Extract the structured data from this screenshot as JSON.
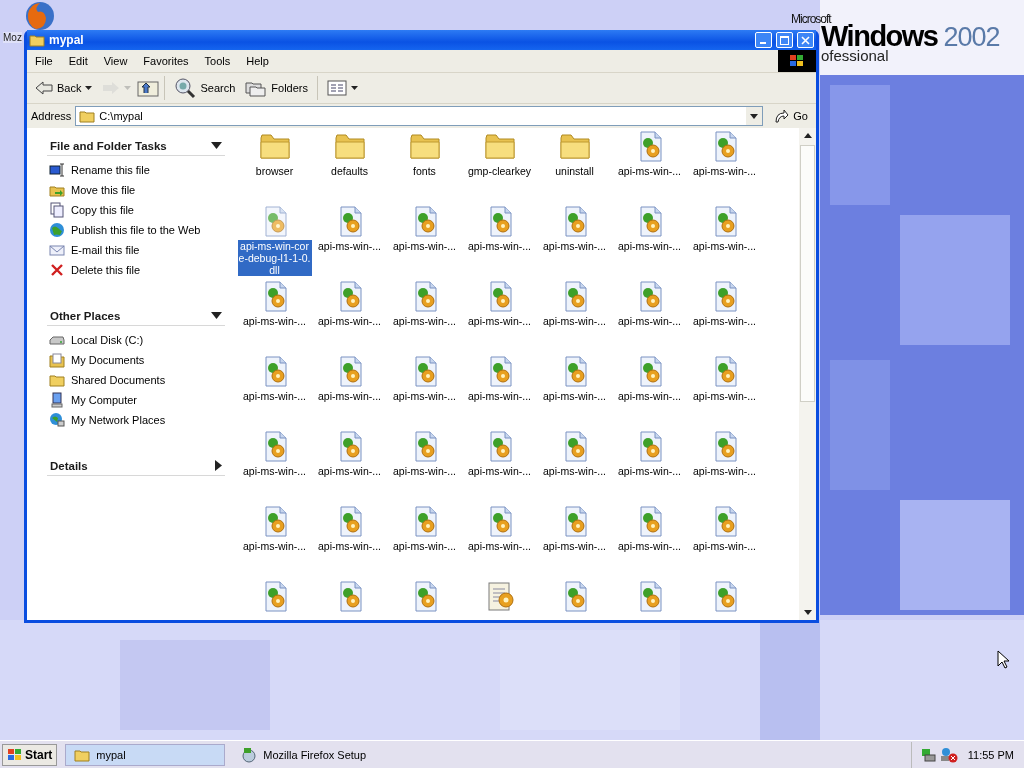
{
  "desktop": {
    "icons": [
      {
        "label": "Moz",
        "kind": "firefox"
      }
    ],
    "logo": {
      "maker": "Microsoft",
      "product": "Windows",
      "version": "2002",
      "edition": "ofessional"
    }
  },
  "window": {
    "title": "mypal",
    "menu": [
      "File",
      "Edit",
      "View",
      "Favorites",
      "Tools",
      "Help"
    ],
    "toolbar": [
      {
        "kind": "back",
        "label": "Back",
        "disabled": false
      },
      {
        "kind": "forward",
        "disabled": true
      },
      {
        "kind": "up"
      },
      {
        "kind": "search",
        "label": "Search"
      },
      {
        "kind": "folders",
        "label": "Folders"
      },
      {
        "kind": "views"
      }
    ],
    "address": {
      "label": "Address",
      "value": "C:\\mypal",
      "go": "Go"
    },
    "sidebar": [
      {
        "title": "File and Folder Tasks",
        "expanded": true,
        "items": [
          {
            "label": "Rename this file",
            "kind": "rename"
          },
          {
            "label": "Move this file",
            "kind": "move"
          },
          {
            "label": "Copy this file",
            "kind": "copy"
          },
          {
            "label": "Publish this file to the Web",
            "kind": "publish"
          },
          {
            "label": "E-mail this file",
            "kind": "email"
          },
          {
            "label": "Delete this file",
            "kind": "delete"
          }
        ]
      },
      {
        "title": "Other Places",
        "expanded": true,
        "items": [
          {
            "label": "Local Disk (C:)",
            "kind": "disk"
          },
          {
            "label": "My Documents",
            "kind": "documents"
          },
          {
            "label": "Shared Documents",
            "kind": "folder"
          },
          {
            "label": "My Computer",
            "kind": "computer"
          },
          {
            "label": "My Network Places",
            "kind": "network"
          }
        ]
      },
      {
        "title": "Details",
        "expanded": false
      }
    ],
    "files": [
      {
        "name": "browser",
        "kind": "folder",
        "selected": false
      },
      {
        "name": "defaults",
        "kind": "folder",
        "selected": false
      },
      {
        "name": "fonts",
        "kind": "folder",
        "selected": false
      },
      {
        "name": "gmp-clearkey",
        "kind": "folder",
        "selected": false
      },
      {
        "name": "uninstall",
        "kind": "folder",
        "selected": false
      },
      {
        "name": "api-ms-win-...",
        "kind": "dll",
        "selected": false
      },
      {
        "name": "api-ms-win-...",
        "kind": "dll",
        "selected": false
      },
      {
        "name": "api-ms-win-core-debug-l1-1-0.dll",
        "kind": "dll",
        "selected": true
      },
      {
        "name": "api-ms-win-...",
        "kind": "dll",
        "selected": false
      },
      {
        "name": "api-ms-win-...",
        "kind": "dll",
        "selected": false
      },
      {
        "name": "api-ms-win-...",
        "kind": "dll",
        "selected": false
      },
      {
        "name": "api-ms-win-...",
        "kind": "dll",
        "selected": false
      },
      {
        "name": "api-ms-win-...",
        "kind": "dll",
        "selected": false
      },
      {
        "name": "api-ms-win-...",
        "kind": "dll",
        "selected": false
      },
      {
        "name": "api-ms-win-...",
        "kind": "dll",
        "selected": false
      },
      {
        "name": "api-ms-win-...",
        "kind": "dll",
        "selected": false
      },
      {
        "name": "api-ms-win-...",
        "kind": "dll",
        "selected": false
      },
      {
        "name": "api-ms-win-...",
        "kind": "dll",
        "selected": false
      },
      {
        "name": "api-ms-win-...",
        "kind": "dll",
        "selected": false
      },
      {
        "name": "api-ms-win-...",
        "kind": "dll",
        "selected": false
      },
      {
        "name": "api-ms-win-...",
        "kind": "dll",
        "selected": false
      },
      {
        "name": "api-ms-win-...",
        "kind": "dll",
        "selected": false
      },
      {
        "name": "api-ms-win-...",
        "kind": "dll",
        "selected": false
      },
      {
        "name": "api-ms-win-...",
        "kind": "dll",
        "selected": false
      },
      {
        "name": "api-ms-win-...",
        "kind": "dll",
        "selected": false
      },
      {
        "name": "api-ms-win-...",
        "kind": "dll",
        "selected": false
      },
      {
        "name": "api-ms-win-...",
        "kind": "dll",
        "selected": false
      },
      {
        "name": "api-ms-win-...",
        "kind": "dll",
        "selected": false
      },
      {
        "name": "api-ms-win-...",
        "kind": "dll",
        "selected": false
      },
      {
        "name": "api-ms-win-...",
        "kind": "dll",
        "selected": false
      },
      {
        "name": "api-ms-win-...",
        "kind": "dll",
        "selected": false
      },
      {
        "name": "api-ms-win-...",
        "kind": "dll",
        "selected": false
      },
      {
        "name": "api-ms-win-...",
        "kind": "dll",
        "selected": false
      },
      {
        "name": "api-ms-win-...",
        "kind": "dll",
        "selected": false
      },
      {
        "name": "api-ms-win-...",
        "kind": "dll",
        "selected": false
      },
      {
        "name": "api-ms-win-...",
        "kind": "dll",
        "selected": false
      },
      {
        "name": "api-ms-win-...",
        "kind": "dll",
        "selected": false
      },
      {
        "name": "api-ms-win-...",
        "kind": "dll",
        "selected": false
      },
      {
        "name": "api-ms-win-...",
        "kind": "dll",
        "selected": false
      },
      {
        "name": "api-ms-win-...",
        "kind": "dll",
        "selected": false
      },
      {
        "name": "api-ms-win-...",
        "kind": "dll",
        "selected": false
      },
      {
        "name": "api-ms-win-...",
        "kind": "dll",
        "selected": false
      },
      {
        "kind": "dll",
        "selected": false
      },
      {
        "kind": "dll",
        "selected": false
      },
      {
        "kind": "dll",
        "selected": false
      },
      {
        "kind": "application",
        "selected": false
      },
      {
        "kind": "dll",
        "selected": false
      },
      {
        "kind": "dll",
        "selected": false
      },
      {
        "kind": "dll",
        "selected": false
      }
    ]
  },
  "taskbar": {
    "start": "Start",
    "tasks": [
      {
        "label": "mypal",
        "kind": "folder",
        "selected": true
      },
      {
        "label": "Mozilla Firefox Setup",
        "kind": "setup",
        "selected": false
      }
    ],
    "clock": "11:55 PM"
  }
}
